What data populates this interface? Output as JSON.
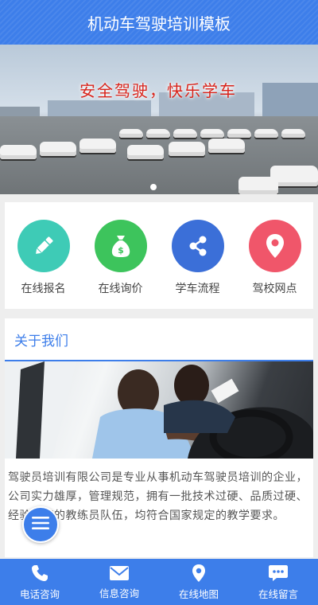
{
  "header": {
    "title": "机动车驾驶培训模板"
  },
  "banner": {
    "slogan": "安全驾驶，快乐学车",
    "slide_count": 1,
    "active_slide": 1
  },
  "quick_links": [
    {
      "label": "在线报名",
      "icon": "pencil-icon",
      "color": "#3ecbb6"
    },
    {
      "label": "在线询价",
      "icon": "money-bag-icon",
      "color": "#3dc45c"
    },
    {
      "label": "学车流程",
      "icon": "share-icon",
      "color": "#3b6fd8"
    },
    {
      "label": "驾校网点",
      "icon": "location-pin-icon",
      "color": "#f0566a"
    }
  ],
  "about": {
    "title": "关于我们",
    "text": "驾驶员培训有限公司是专业从事机动车驾驶员培训的企业，公司实力雄厚，管理规范，拥有一批技术过硬、品质过硬、经验丰富的教练员队伍，均符合国家规定的教学要求。"
  },
  "footer": [
    {
      "label": "电话咨询",
      "icon": "phone-icon"
    },
    {
      "label": "信息咨询",
      "icon": "envelope-icon"
    },
    {
      "label": "在线地图",
      "icon": "map-pin-icon"
    },
    {
      "label": "在线留言",
      "icon": "chat-icon"
    }
  ],
  "colors": {
    "primary": "#3d7eea",
    "background": "#eeeeee"
  },
  "fab": {
    "icon": "menu-icon"
  }
}
